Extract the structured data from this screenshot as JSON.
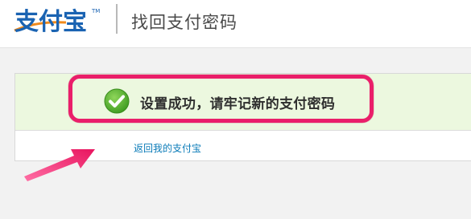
{
  "header": {
    "logo_text": "支付宝",
    "logo_mark": "TM",
    "page_title": "找回支付密码"
  },
  "result": {
    "message": "设置成功，请牢记新的支付密码",
    "return_link": "返回我的支付宝"
  },
  "colors": {
    "logo_blue": "#1a63b2",
    "logo_orange": "#f08a1c",
    "success_bg": "#ecf8df",
    "success_icon": "#4fae2a",
    "highlight": "#ea1f6a",
    "link": "#0a7bb8"
  },
  "icons": {
    "check": "check-circle-icon",
    "annotation_arrow": "arrow-icon"
  }
}
